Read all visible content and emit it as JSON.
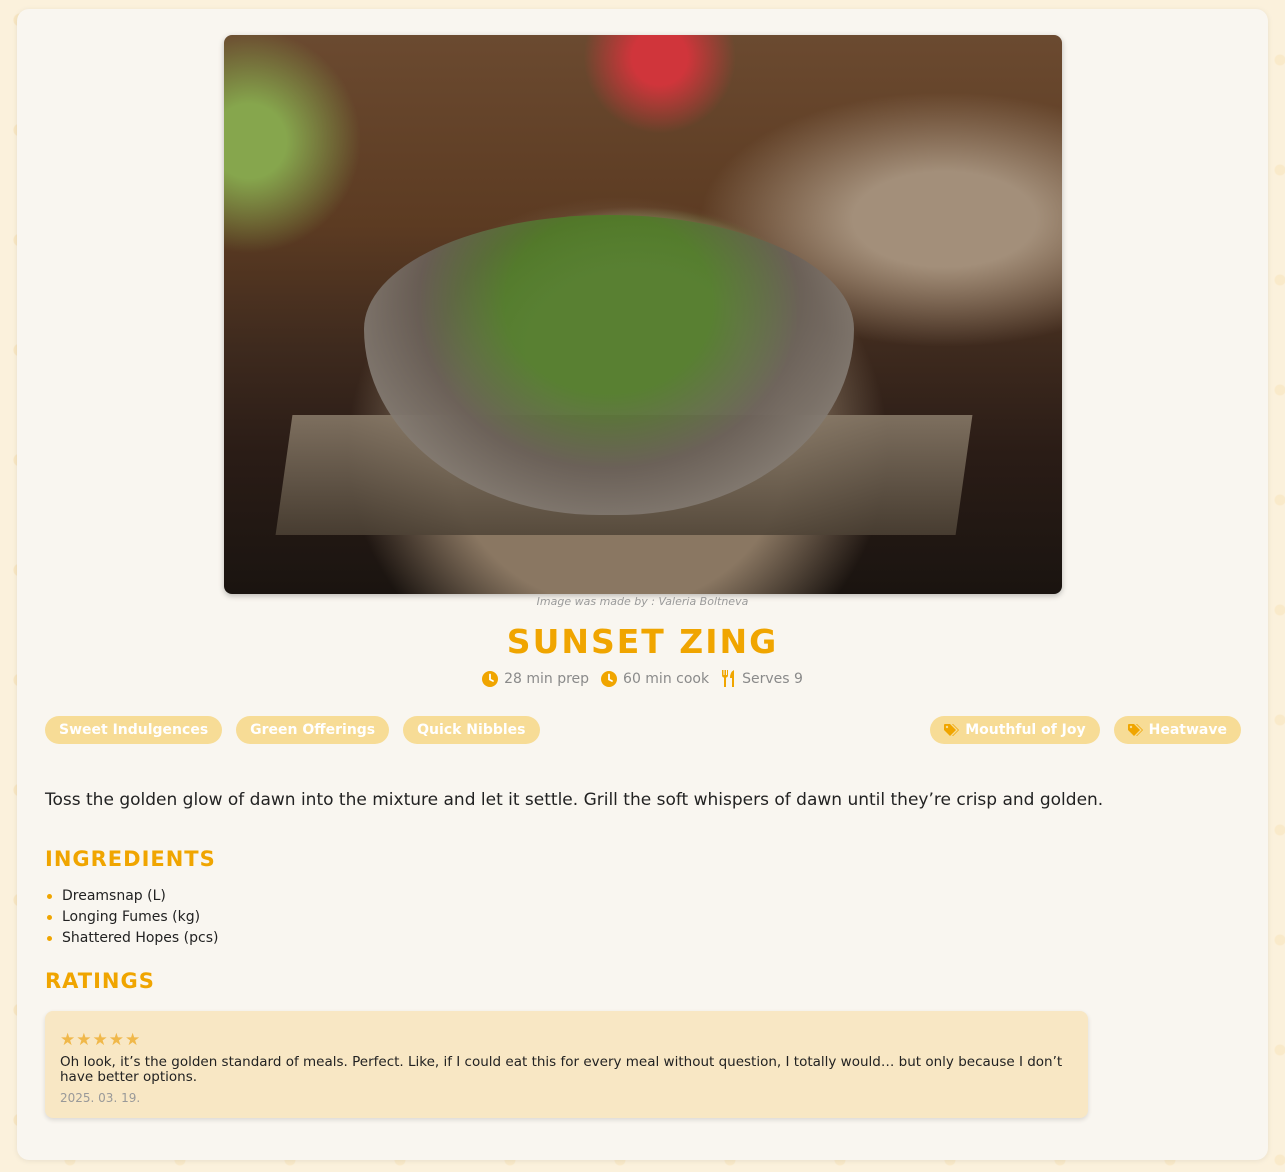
{
  "recipe": {
    "image_alt": "Bowl of green salad with grilled vegetables on a wooden board",
    "image_credit": "Image was made by : Valeria Boltneva",
    "title": "SUNSET ZING",
    "prep": "28 min prep",
    "cook": "60 min cook",
    "serves": "Serves 9",
    "categories": [
      "Sweet Indulgences",
      "Green Offerings",
      "Quick Nibbles"
    ],
    "labels": [
      "Mouthful of Joy",
      "Heatwave"
    ],
    "description": "Toss the golden glow of dawn into the mixture and let it settle. Grill the soft whispers of dawn until they’re crisp and golden."
  },
  "ingredients": {
    "heading": "INGREDIENTS",
    "items": [
      "Dreamsnap (L)",
      "Longing Fumes (kg)",
      "Shattered Hopes (pcs)"
    ]
  },
  "ratings": {
    "heading": "RATINGS",
    "reviews": [
      {
        "stars": 5,
        "text": "Oh look, it’s the golden standard of meals. Perfect. Like, if I could eat this for every meal without question, I totally would… but only because I don’t have better options.",
        "date": "2025. 03. 19."
      }
    ]
  },
  "colors": {
    "accent": "#f0a500",
    "tag_bg": "#f7dc96",
    "review_bg": "#f8e7c4",
    "card_bg": "#f9f6f0"
  },
  "icons": {
    "prep": "clock-icon",
    "cook": "clock-icon",
    "serves": "fork-knife-icon",
    "label": "tag-icon",
    "rating": "star-icon"
  }
}
